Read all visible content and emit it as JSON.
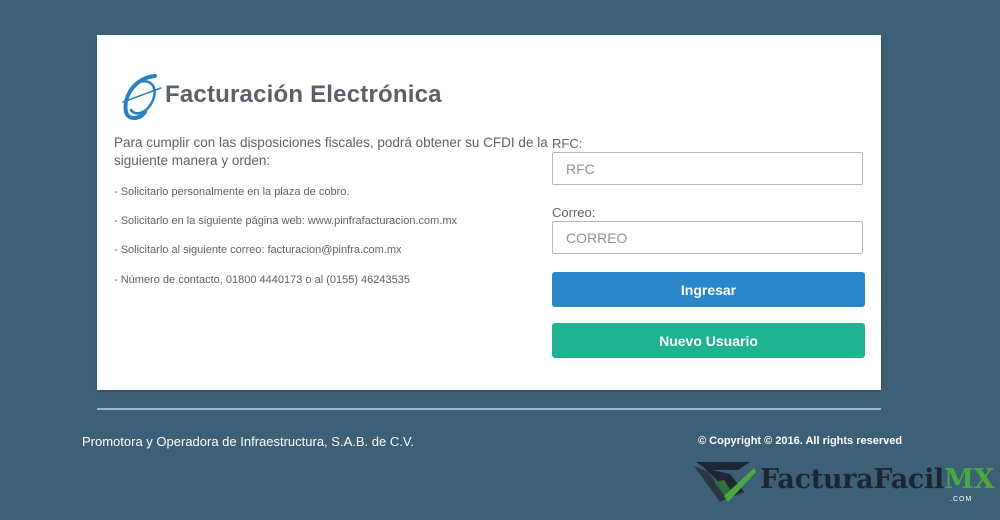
{
  "header": {
    "title": "Facturación Electrónica"
  },
  "instructions": {
    "intro": "Para cumplir con las disposiciones fiscales, podrá obtener su CFDI de la siguiente manera y orden:",
    "items": [
      "- Solicitarlo personalmente en la plaza de cobro.",
      "- Solicitarlo en la siguiente página web: www.pinfrafacturacion.com.mx",
      "- Solicitarlo al siguiente correo: facturacion@pinfra.com.mx",
      "- Número de contacto, 01800 4440173 o al (0155) 46243535"
    ]
  },
  "form": {
    "rfc_label": "RFC:",
    "rfc_placeholder": "RFC",
    "rfc_value": "",
    "email_label": "Correo:",
    "email_placeholder": "CORREO",
    "email_value": "",
    "login_button": "Ingresar",
    "new_user_button": "Nuevo Usuario"
  },
  "footer": {
    "company": "Promotora y Operadora de Infraestructura, S.A.B. de C.V.",
    "copyright": "© Copyright © 2016. All rights reserved"
  },
  "watermark": {
    "brand": "FacturaFacil",
    "brand_suffix": "MX",
    "domain": ".COM",
    "icon": "checkmark-logo-icon"
  },
  "colors": {
    "page_background": "#3d6079",
    "card_background": "#ffffff",
    "primary_button": "#2b86c9",
    "success_button": "#1fb394",
    "text": "#5d626a",
    "logo_blue": "#2a7fc0",
    "watermark_green": "#4aa843"
  },
  "icons": {
    "logo": "facturacion-logo-icon"
  }
}
